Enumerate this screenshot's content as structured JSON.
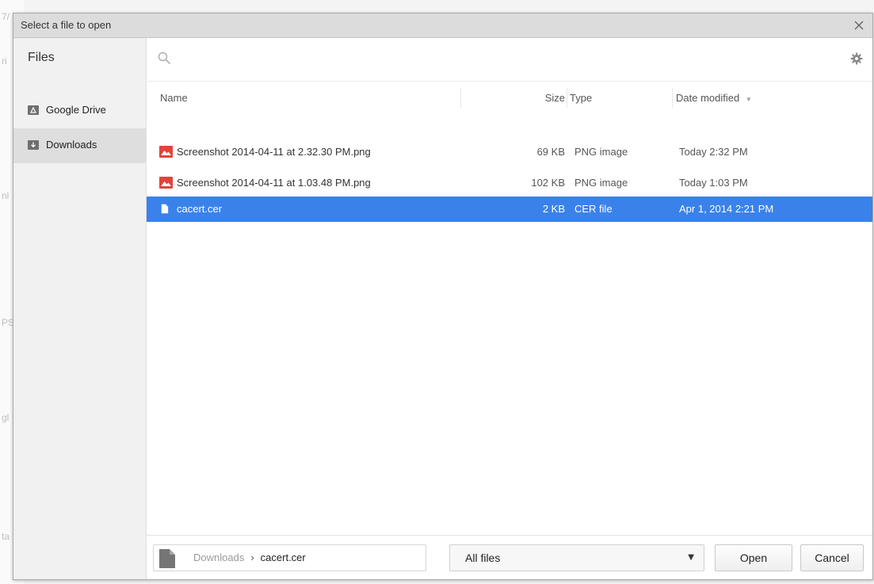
{
  "dialog": {
    "title": "Select a file to open"
  },
  "sidebar": {
    "title": "Files",
    "items": [
      {
        "label": "Google Drive",
        "icon": "google-drive-icon",
        "selected": false
      },
      {
        "label": "Downloads",
        "icon": "downloads-icon",
        "selected": true
      }
    ]
  },
  "search": {
    "value": "",
    "placeholder": ""
  },
  "columns": {
    "name": "Name",
    "size": "Size",
    "type": "Type",
    "date": "Date modified"
  },
  "files": [
    {
      "name": "Screenshot 2014-04-11 at 2.32.30 PM.png",
      "size": "69 KB",
      "type": "PNG image",
      "date": "Today 2:32 PM",
      "icon": "image-file-icon",
      "selected": false
    },
    {
      "name": "Screenshot 2014-04-11 at 1.03.48 PM.png",
      "size": "102 KB",
      "type": "PNG image",
      "date": "Today 1:03 PM",
      "icon": "image-file-icon",
      "selected": false
    },
    {
      "name": "cacert.cer",
      "size": "2 KB",
      "type": "CER file",
      "date": "Apr 1, 2014 2:21 PM",
      "icon": "generic-file-icon",
      "selected": true
    }
  ],
  "footer": {
    "breadcrumb_dir": "Downloads",
    "breadcrumb_sep": "›",
    "breadcrumb_file": "cacert.cer",
    "filter_value": "All files",
    "open_label": "Open",
    "cancel_label": "Cancel"
  },
  "colors": {
    "accent": "#3a82ea",
    "image_icon": "#e0443a",
    "titlebar": "#dcdcdc",
    "sidebar": "#f1f1f1"
  }
}
